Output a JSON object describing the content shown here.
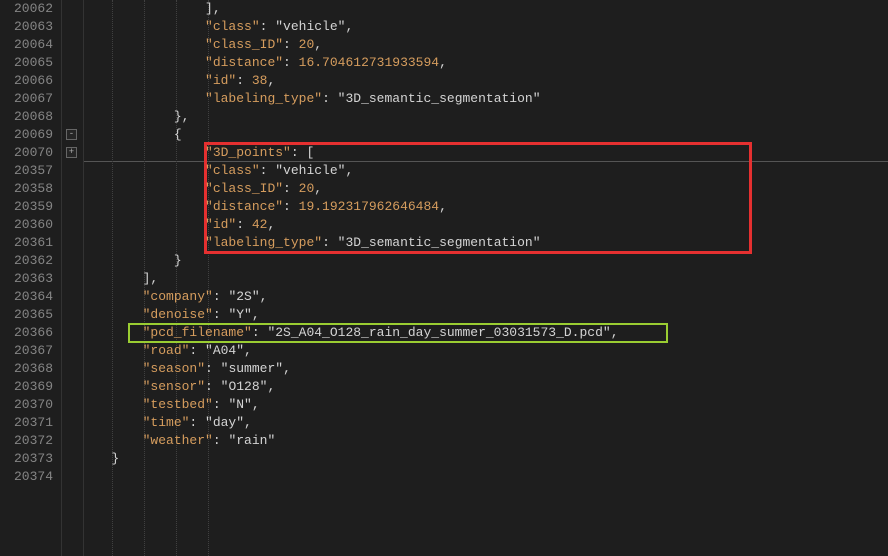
{
  "lineNumbers": [
    "20062",
    "20063",
    "20064",
    "20065",
    "20066",
    "20067",
    "20068",
    "20069",
    "20070",
    "20357",
    "20358",
    "20359",
    "20360",
    "20361",
    "20362",
    "20363",
    "20364",
    "20365",
    "20366",
    "20367",
    "20368",
    "20369",
    "20370",
    "20371",
    "20372",
    "20373",
    "20374"
  ],
  "fold": {
    "collapsed_glyph": "+",
    "expanded_glyph": "-"
  },
  "obj1": {
    "close_bracket": "],",
    "class_key": "\"class\"",
    "class_val": "\"vehicle\"",
    "class_id_key": "\"class_ID\"",
    "class_id_val": "20",
    "distance_key": "\"distance\"",
    "distance_val": "16.704612731933594",
    "id_key": "\"id\"",
    "id_val": "38",
    "labeling_key": "\"labeling_type\"",
    "labeling_val": "\"3D_semantic_segmentation\""
  },
  "obj2": {
    "points_key": "\"3D_points\"",
    "points_open": ": [",
    "class_key": "\"class\"",
    "class_val": "\"vehicle\"",
    "class_id_key": "\"class_ID\"",
    "class_id_val": "20",
    "distance_key": "\"distance\"",
    "distance_val": "19.192317962646484",
    "id_key": "\"id\"",
    "id_val": "42",
    "labeling_key": "\"labeling_type\"",
    "labeling_val": "\"3D_semantic_segmentation\""
  },
  "meta": {
    "company_key": "\"company\"",
    "company_val": "\"2S\"",
    "denoise_key": "\"denoise\"",
    "denoise_val": "\"Y\"",
    "pcd_key": "\"pcd_filename\"",
    "pcd_val": "\"2S_A04_O128_rain_day_summer_03031573_D.pcd\"",
    "road_key": "\"road\"",
    "road_val": "\"A04\"",
    "season_key": "\"season\"",
    "season_val": "\"summer\"",
    "sensor_key": "\"sensor\"",
    "sensor_val": "\"O128\"",
    "testbed_key": "\"testbed\"",
    "testbed_val": "\"N\"",
    "time_key": "\"time\"",
    "time_val": "\"day\"",
    "weather_key": "\"weather\"",
    "weather_val": "\"rain\""
  },
  "punct": {
    "colon": ": ",
    "comma": ",",
    "brace_close_comma": "},",
    "brace_open": "{",
    "bracket_close_comma": "],",
    "brace_close": "}"
  }
}
